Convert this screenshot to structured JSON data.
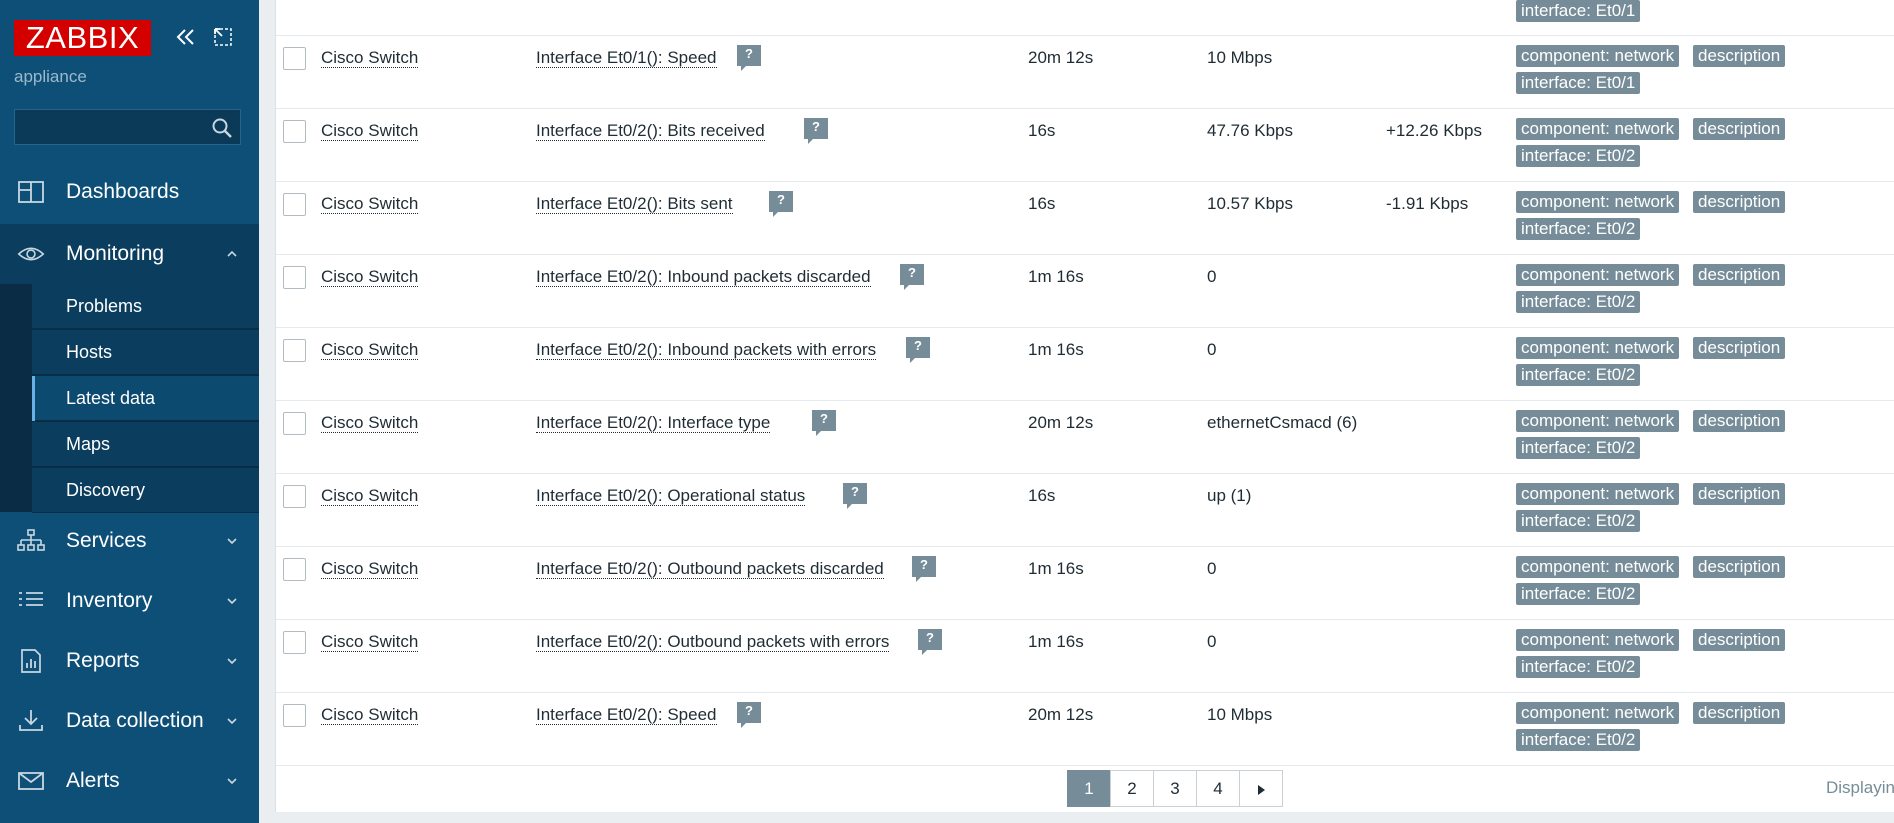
{
  "sidebar": {
    "logo": "ZABBIX",
    "server_name": "appliance",
    "search": {
      "value": "",
      "placeholder": ""
    },
    "nav": [
      {
        "label": "Dashboards",
        "icon": "dashboards-icon"
      },
      {
        "label": "Monitoring",
        "icon": "eye-icon"
      },
      {
        "label": "Services",
        "icon": "services-icon"
      },
      {
        "label": "Inventory",
        "icon": "list-icon"
      },
      {
        "label": "Reports",
        "icon": "reports-icon"
      },
      {
        "label": "Data collection",
        "icon": "download-icon"
      },
      {
        "label": "Alerts",
        "icon": "envelope-icon"
      }
    ],
    "monitoring_sub": [
      {
        "label": "Problems"
      },
      {
        "label": "Hosts"
      },
      {
        "label": "Latest data"
      },
      {
        "label": "Maps"
      },
      {
        "label": "Discovery"
      }
    ],
    "active_sub": "Latest data"
  },
  "table": {
    "partial_top_tag": "interface: Et0/1",
    "rows": [
      {
        "host": "Cisco Switch",
        "item": "Interface Et0/1(): Speed",
        "last_check": "20m 12s",
        "last_value": "10 Mbps",
        "change": "",
        "tags": [
          "component: network",
          "description",
          "interface: Et0/1"
        ]
      },
      {
        "host": "Cisco Switch",
        "item": "Interface Et0/2(): Bits received",
        "last_check": "16s",
        "last_value": "47.76 Kbps",
        "change": "+12.26 Kbps",
        "tags": [
          "component: network",
          "description",
          "interface: Et0/2"
        ]
      },
      {
        "host": "Cisco Switch",
        "item": "Interface Et0/2(): Bits sent",
        "last_check": "16s",
        "last_value": "10.57 Kbps",
        "change": "-1.91 Kbps",
        "tags": [
          "component: network",
          "description",
          "interface: Et0/2"
        ]
      },
      {
        "host": "Cisco Switch",
        "item": "Interface Et0/2(): Inbound packets discarded",
        "last_check": "1m 16s",
        "last_value": "0",
        "change": "",
        "tags": [
          "component: network",
          "description",
          "interface: Et0/2"
        ]
      },
      {
        "host": "Cisco Switch",
        "item": "Interface Et0/2(): Inbound packets with errors",
        "last_check": "1m 16s",
        "last_value": "0",
        "change": "",
        "tags": [
          "component: network",
          "description",
          "interface: Et0/2"
        ]
      },
      {
        "host": "Cisco Switch",
        "item": "Interface Et0/2(): Interface type",
        "last_check": "20m 12s",
        "last_value": "ethernetCsmacd (6)",
        "change": "",
        "tags": [
          "component: network",
          "description",
          "interface: Et0/2"
        ]
      },
      {
        "host": "Cisco Switch",
        "item": "Interface Et0/2(): Operational status",
        "last_check": "16s",
        "last_value": "up (1)",
        "change": "",
        "tags": [
          "component: network",
          "description",
          "interface: Et0/2"
        ]
      },
      {
        "host": "Cisco Switch",
        "item": "Interface Et0/2(): Outbound packets discarded",
        "last_check": "1m 16s",
        "last_value": "0",
        "change": "",
        "tags": [
          "component: network",
          "description",
          "interface: Et0/2"
        ]
      },
      {
        "host": "Cisco Switch",
        "item": "Interface Et0/2(): Outbound packets with errors",
        "last_check": "1m 16s",
        "last_value": "0",
        "change": "",
        "tags": [
          "component: network",
          "description",
          "interface: Et0/2"
        ]
      },
      {
        "host": "Cisco Switch",
        "item": "Interface Et0/2(): Speed",
        "last_check": "20m 12s",
        "last_value": "10 Mbps",
        "change": "",
        "tags": [
          "component: network",
          "description",
          "interface: Et0/2"
        ]
      }
    ],
    "help_glyph": "?"
  },
  "pagination": {
    "pages": [
      "1",
      "2",
      "3",
      "4"
    ],
    "current": "1",
    "next_icon": "next-page-icon",
    "displaying": "Displaying"
  },
  "colors": {
    "sidebar_bg": "#0e4f78",
    "logo_bg": "#d40000",
    "tag_bg": "#768d99"
  }
}
